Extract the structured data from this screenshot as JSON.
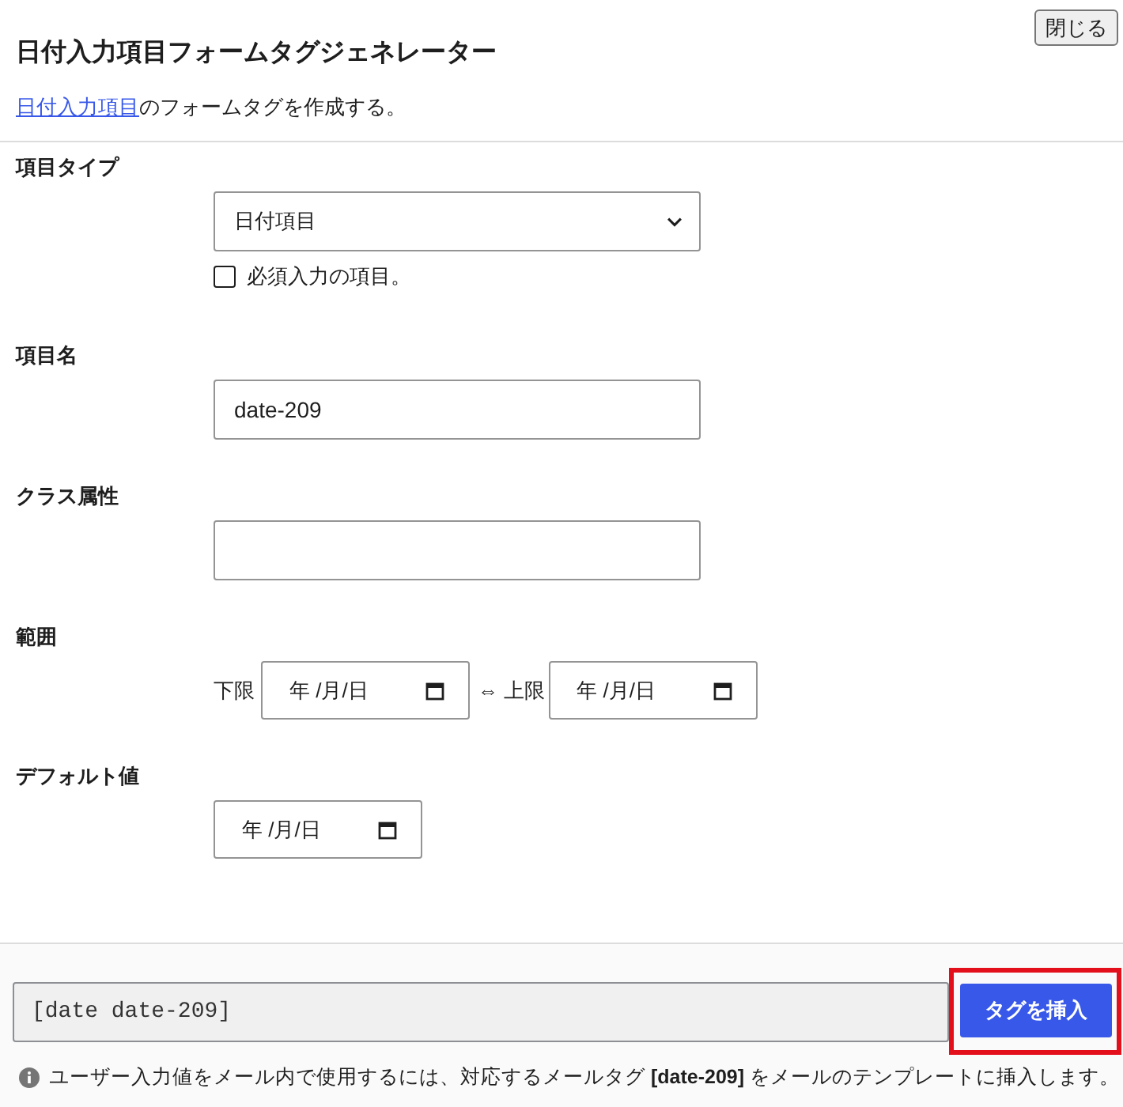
{
  "header": {
    "title": "日付入力項目フォームタグジェネレーター",
    "close_button": "閉じる"
  },
  "description": {
    "link": "日付入力項目",
    "text": "のフォームタグを作成する。"
  },
  "fields": [
    {
      "kind": "select",
      "label": "項目タイプ",
      "value": "日付項目",
      "checkbox": {
        "label": "必須入力の項目。",
        "checked": false
      }
    },
    {
      "kind": "text",
      "label": "項目名",
      "value": "date-209"
    },
    {
      "kind": "text",
      "label": "クラス属性"
    },
    {
      "kind": "range",
      "label": "範囲",
      "lower": {
        "label": "下限",
        "placeholder": "年 /月/日"
      },
      "upper": {
        "label": "⇔ 上限",
        "placeholder": "年 /月/日"
      }
    },
    {
      "kind": "date",
      "label": "デフォルト値",
      "placeholder": "年 /月/日"
    }
  ],
  "footer": {
    "tag": "[date date-209]",
    "insert_button": {
      "label": "タグを挿入",
      "highlighted": true
    },
    "note": "ユーザー入力値をメール内で使用するには、対応するメールタグ **[date-209]** をメールのテンプレートに挿入します。"
  }
}
